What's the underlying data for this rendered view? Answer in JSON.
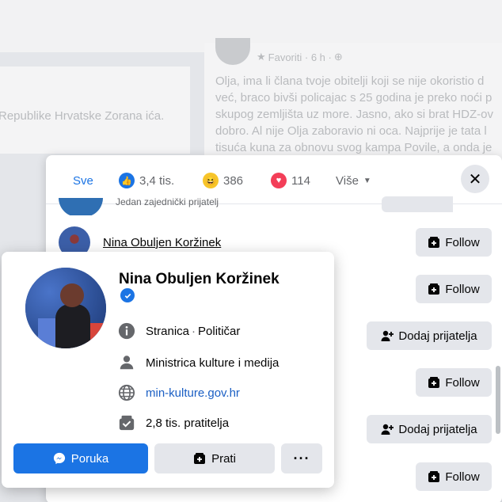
{
  "background": {
    "left_card_text": "Republike Hrvatske Zorana ića.",
    "post_meta": "Favoriti · 6 h ·",
    "post_lines": [
      "Olja, ima li člana tvoje obitelji koji se nije okoristio d",
      "već, braco bivši policajac s 25 godina je preko noći p",
      "skupog zemljišta uz more. Jasno, ako si brat HDZ-ov",
      "dobro. Al nije Olja zaboravio ni oca. Najprije je tata l",
      "tisuća kuna za obnovu svog kampa Povile, a onda je"
    ]
  },
  "dialog": {
    "tabs": {
      "all": "Sve",
      "like_count": "3,4 tis.",
      "haha_count": "386",
      "love_count": "114",
      "more": "Više"
    },
    "faded_row_text": "Jedan zajednički prijatelj",
    "first_person_name": "Nina Obuljen Koržinek",
    "buttons": {
      "follow": "Follow",
      "add_friend": "Dodaj prijatelja"
    }
  },
  "hovercard": {
    "name": "Nina Obuljen Koržinek",
    "type_bold": "Stranica",
    "type_rest": "Političar",
    "job": "Ministrica kulture i medija",
    "website": "min-kulture.gov.hr",
    "followers": "2,8 tis. pratitelja",
    "message_label": "Poruka",
    "follow_label": "Prati",
    "more_label": "···"
  },
  "colors": {
    "accent": "#1b74e4",
    "button_gray": "#e4e6eb"
  }
}
